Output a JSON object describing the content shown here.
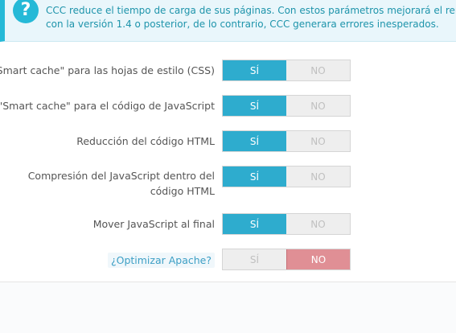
{
  "info": {
    "icon": "question-icon",
    "line1": "CCC reduce el tiempo de carga de sus páginas. Con estos parámetros mejorará el rendimiento",
    "line2": "con la versión 1.4 o posterior, de lo contrario, CCC generara errores inesperados."
  },
  "settings": [
    {
      "label": "\"Smart cache\" para las hojas de estilo (CSS)",
      "yes": "SÍ",
      "no": "NO",
      "value": "yes"
    },
    {
      "label": "\"Smart cache\" para el código de JavaScript",
      "yes": "SÍ",
      "no": "NO",
      "value": "yes"
    },
    {
      "label": "Reducción del código HTML",
      "yes": "SÍ",
      "no": "NO",
      "value": "yes"
    },
    {
      "label_line1": "Compresión del JavaScript dentro del",
      "label_line2": "código HTML",
      "yes": "SÍ",
      "no": "NO",
      "value": "yes"
    },
    {
      "label": "Mover JavaScript al final",
      "yes": "SÍ",
      "no": "NO",
      "value": "yes"
    },
    {
      "label": "¿Optimizar Apache?",
      "yes": "SÍ",
      "no": "NO",
      "value": "no"
    }
  ],
  "colors": {
    "accent": "#2eacce",
    "no_active": "#e08f95",
    "info_bg": "#e9f6fb"
  }
}
